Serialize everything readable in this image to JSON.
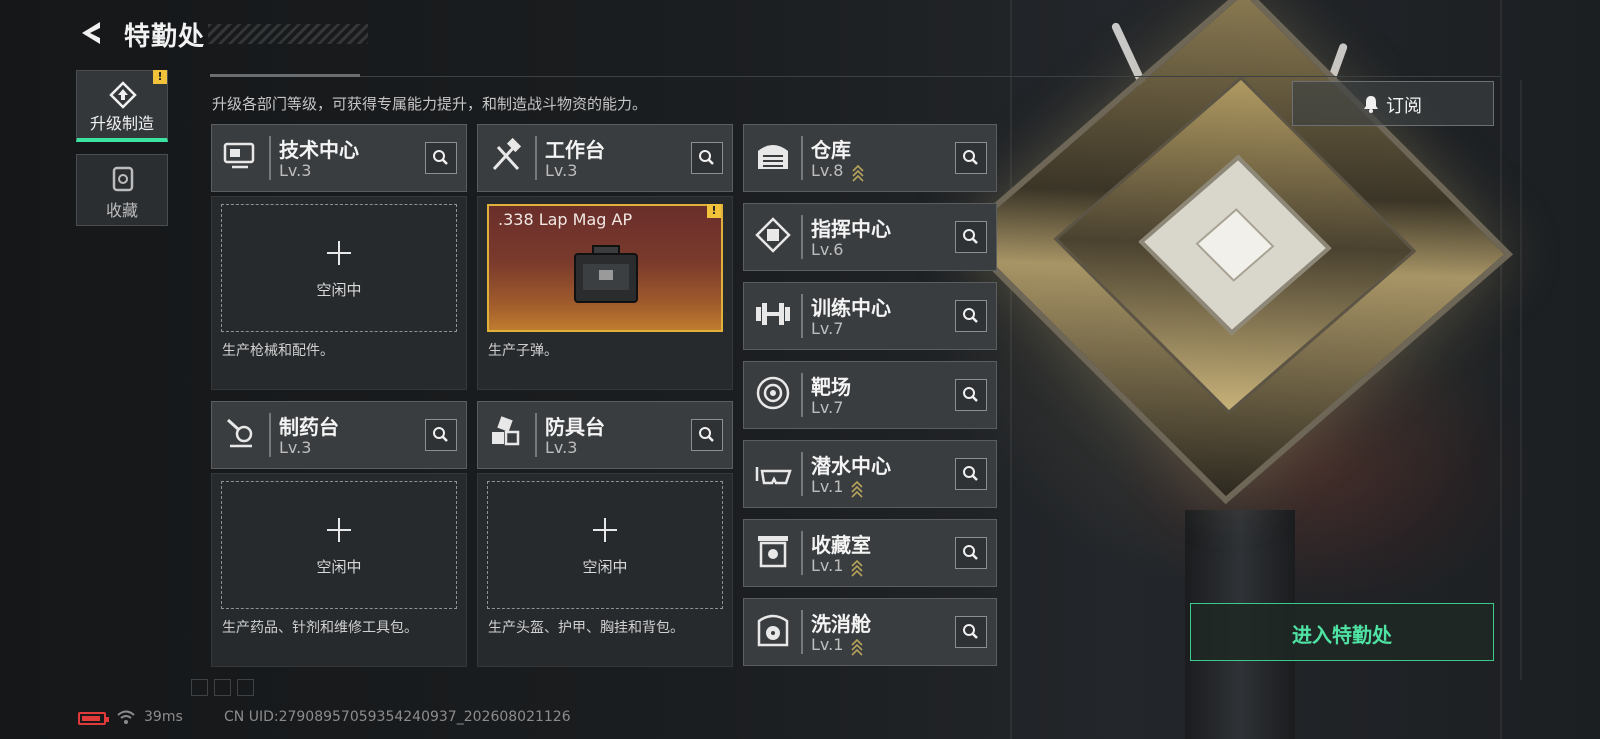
{
  "header": {
    "title": "特勤处",
    "back_icon": "back-arrow-icon"
  },
  "nav": [
    {
      "label": "升级制造",
      "icon": "upgrade-icon",
      "active": true,
      "alert": "!"
    },
    {
      "label": "收藏",
      "icon": "collection-icon",
      "active": false
    }
  ],
  "intro": "升级各部门等级，可获得专属能力提升，和制造战斗物资的能力。",
  "subscribe": {
    "label": "订阅",
    "icon": "bell-icon"
  },
  "production": [
    {
      "name": "技术中心",
      "level": "Lv.3",
      "icon": "tech-center-icon",
      "status": "空闲中",
      "desc": "生产枪械和配件。"
    },
    {
      "name": "工作台",
      "level": "Lv.3",
      "icon": "workbench-icon",
      "product": ".338 Lap Mag AP",
      "alert": "!",
      "desc": "生产子弹。"
    },
    {
      "name": "制药台",
      "level": "Lv.3",
      "icon": "pharmacy-icon",
      "status": "空闲中",
      "desc": "生产药品、针剂和维修工具包。"
    },
    {
      "name": "防具台",
      "level": "Lv.3",
      "icon": "armor-bench-icon",
      "status": "空闲中",
      "desc": "生产头盔、护甲、胸挂和背包。"
    }
  ],
  "facilities": [
    {
      "name": "仓库",
      "level": "Lv.8",
      "icon": "warehouse-icon",
      "upgradable": true
    },
    {
      "name": "指挥中心",
      "level": "Lv.6",
      "icon": "command-center-icon",
      "upgradable": false
    },
    {
      "name": "训练中心",
      "level": "Lv.7",
      "icon": "training-icon",
      "upgradable": false
    },
    {
      "name": "靶场",
      "level": "Lv.7",
      "icon": "target-icon",
      "upgradable": false
    },
    {
      "name": "潜水中心",
      "level": "Lv.1",
      "icon": "diving-icon",
      "upgradable": true
    },
    {
      "name": "收藏室",
      "level": "Lv.1",
      "icon": "collection-room-icon",
      "upgradable": true
    },
    {
      "name": "洗消舱",
      "level": "Lv.1",
      "icon": "decontamination-icon",
      "upgradable": true
    }
  ],
  "enter_button": "进入特勤处",
  "status": {
    "ping": "39ms",
    "uid": "CN UID:27908957059354240937_202608021126"
  },
  "colors": {
    "accent": "#3be3a0",
    "alert": "#f2c33a",
    "battery": "#e03a3a"
  }
}
